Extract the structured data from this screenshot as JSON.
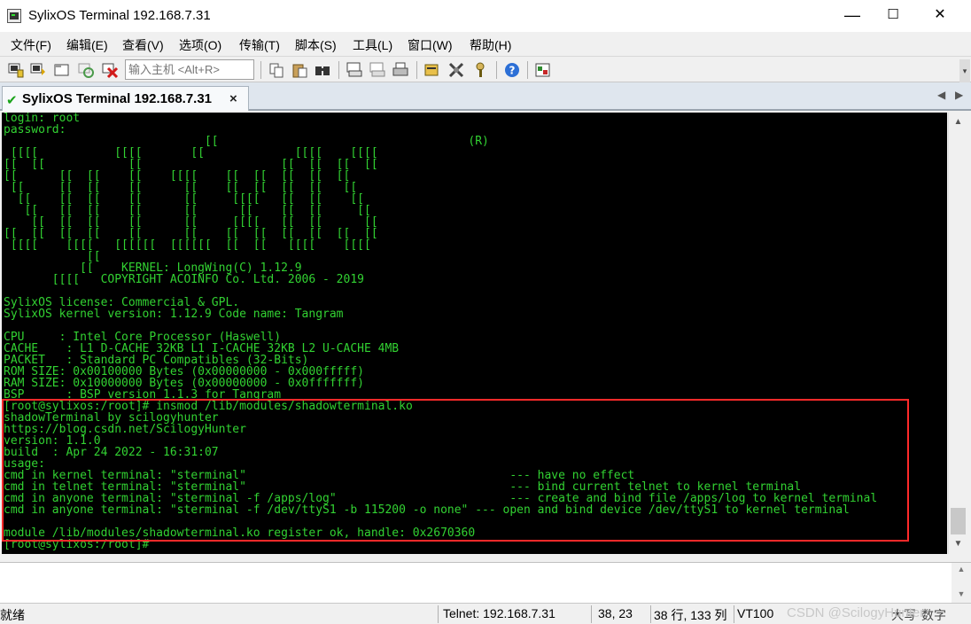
{
  "window": {
    "title": "SylixOS Terminal 192.168.7.31",
    "minimize": "—",
    "maximize": "☐",
    "close": "✕"
  },
  "menu": [
    {
      "label": "文件(F)"
    },
    {
      "label": "编辑(E)"
    },
    {
      "label": "查看(V)"
    },
    {
      "label": "选项(O)"
    },
    {
      "label": "传输(T)"
    },
    {
      "label": "脚本(S)"
    },
    {
      "label": "工具(L)"
    },
    {
      "label": "窗口(W)"
    },
    {
      "label": "帮助(H)"
    }
  ],
  "toolbar": {
    "host_placeholder": "输入主机 <Alt+R>",
    "icons": [
      "connect-icon",
      "quick-connect-icon",
      "connect-tab-icon",
      "reconnect-icon",
      "disconnect-icon",
      "copy-icon",
      "paste-icon",
      "find-icon",
      "print-screen-icon",
      "print-selection-icon",
      "print-icon",
      "session-options-icon",
      "global-options-icon",
      "keymap-icon",
      "help-icon",
      "sftp-icon"
    ]
  },
  "tab": {
    "label": "SylixOS Terminal 192.168.7.31",
    "close": "×",
    "prev": "◀",
    "next": "▶"
  },
  "terminal": {
    "lines": [
      "login: root",
      "password:",
      "                             [[                                    (R)",
      " [[[[           [[[[       [[             [[[[    [[[[",
      "[[  [[            [[                    [[  [[  [[  [[",
      "[[      [[  [[    [[    [[[[    [[  [[  [[  [[  [[",
      " [[     [[  [[    [[      [[    [[  [[  [[  [[   [[",
      "  [[    [[  [[    [[      [[     [[[[   [[  [[    [[",
      "   [[   [[  [[    [[      [[      [[    [[  [[     [[",
      "    [[  [[  [[    [[      [[     [[[[   [[  [[      [[",
      "[[  [[  [[  [[    [[      [[    [[  [[  [[  [[  [[  [[",
      " [[[[    [[[[   [[[[[[  [[[[[[  [[  [[   [[[[    [[[[",
      "            [[",
      "           [[    KERNEL: LongWing(C) 1.12.9",
      "       [[[[   COPYRIGHT ACOINFO Co. Ltd. 2006 - 2019",
      "",
      "SylixOS license: Commercial & GPL.",
      "SylixOS kernel version: 1.12.9 Code name: Tangram",
      "",
      "CPU     : Intel Core Processor (Haswell)",
      "CACHE    : L1 D-CACHE 32KB L1 I-CACHE 32KB L2 U-CACHE 4MB",
      "PACKET   : Standard PC Compatibles (32-Bits)",
      "ROM SIZE: 0x00100000 Bytes (0x00000000 - 0x000fffff)",
      "RAM SIZE: 0x10000000 Bytes (0x00000000 - 0x0fffffff)",
      "BSP      : BSP version 1.1.3 for Tangram",
      "[root@sylixos:/root]# insmod /lib/modules/shadowterminal.ko",
      "shadowTerminal by scilogyhunter",
      "https://blog.csdn.net/ScilogyHunter",
      "version: 1.1.0",
      "build  : Apr 24 2022 - 16:31:07",
      "usage:",
      "cmd in kernel terminal: \"sterminal\"                                      --- have no effect",
      "cmd in telnet terminal: \"sterminal\"                                      --- bind current telnet to kernel terminal",
      "cmd in anyone terminal: \"sterminal -f /apps/log\"                         --- create and bind file /apps/log to kernel terminal",
      "cmd in anyone terminal: \"sterminal -f /dev/ttyS1 -b 115200 -o none\" --- open and bind device /dev/ttyS1 to kernel terminal",
      "",
      "module /lib/modules/shadowterminal.ko register ok, handle: 0x2670360",
      "[root@sylixos:/root]#"
    ]
  },
  "scrollbar": {
    "up": "▲",
    "down": "▼"
  },
  "status": {
    "ready": "就绪",
    "connection": "Telnet: 192.168.7.31",
    "cursor": "38,  23",
    "size": "38 行, 133 列",
    "emulation": "VT100",
    "caps": "大写",
    "num": "数字",
    "watermark": "CSDN @ScilogyHunter"
  }
}
